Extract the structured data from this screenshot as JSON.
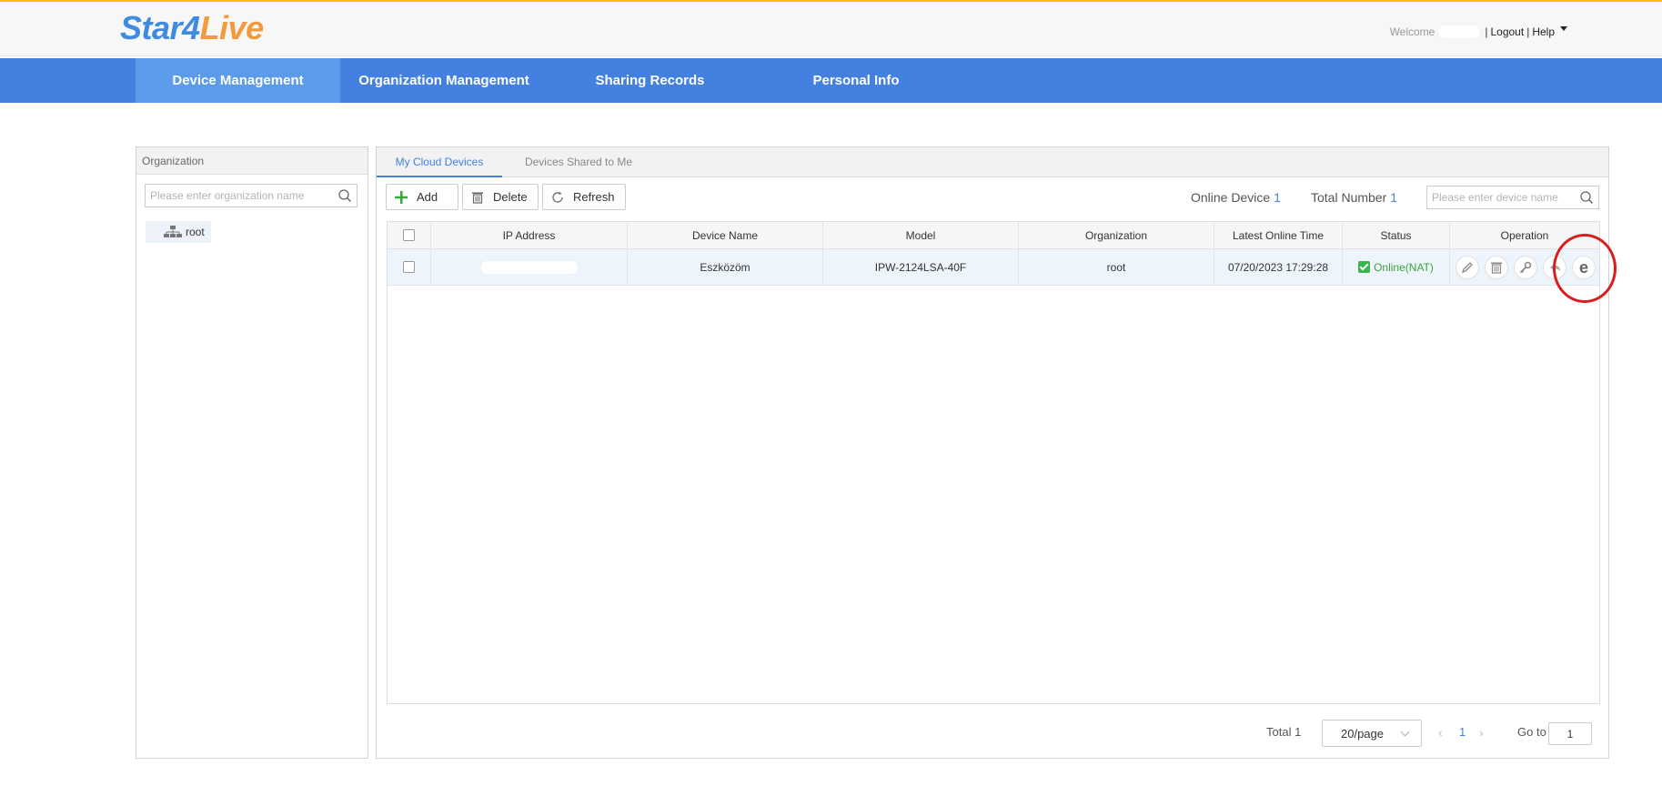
{
  "brand": {
    "logo_part1": "Star4",
    "logo_part2": "Live",
    "accent": "#4480e0",
    "logo_blue": "#3f8be0",
    "logo_orange": "#f39a3c"
  },
  "userbar": {
    "welcome": "Welcome",
    "logout": "Logout",
    "help": "Help"
  },
  "nav": {
    "items": [
      {
        "label": "Device Management"
      },
      {
        "label": "Organization Management"
      },
      {
        "label": "Sharing Records"
      },
      {
        "label": "Personal Info"
      }
    ]
  },
  "org_panel": {
    "title": "Organization",
    "search_placeholder": "Please enter organization name",
    "tree_root": "root"
  },
  "tabs": [
    {
      "label": "My Cloud Devices"
    },
    {
      "label": "Devices Shared to Me"
    }
  ],
  "toolbar": {
    "add": "Add",
    "delete": "Delete",
    "refresh": "Refresh",
    "online_label": "Online Device",
    "online_value": "1",
    "total_label": "Total Number",
    "total_value": "1",
    "device_search_placeholder": "Please enter device name"
  },
  "table": {
    "columns": [
      "IP Address",
      "Device Name",
      "Model",
      "Organization",
      "Latest Online Time",
      "Status",
      "Operation"
    ],
    "rows": [
      {
        "device_name": "Eszközöm",
        "model": "IPW-2124LSA-40F",
        "organization": "root",
        "latest_online": "07/20/2023 17:29:28",
        "status": "Online(NAT)"
      }
    ]
  },
  "pagination": {
    "total_label": "Total",
    "total_value": "1",
    "page_size": "20/page",
    "current_page": "1",
    "goto_label": "Go to",
    "goto_value": "1"
  },
  "icons": [
    "search-icon",
    "tree-org-icon",
    "plus-icon",
    "trash-icon",
    "refresh-icon",
    "edit-icon",
    "key-icon",
    "share-icon",
    "ie-browser-icon",
    "chevron-down-icon",
    "chevron-left-icon",
    "chevron-right-icon"
  ]
}
